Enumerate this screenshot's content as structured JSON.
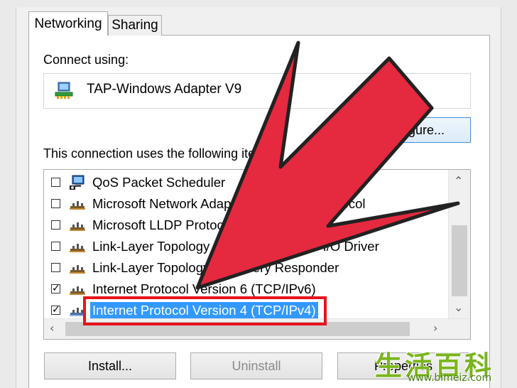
{
  "tabs": [
    {
      "label": "Networking",
      "active": true
    },
    {
      "label": "Sharing",
      "active": false
    }
  ],
  "connect_using": {
    "label": "Connect using:",
    "adapter_name": "TAP-Windows Adapter V9",
    "adapter_icon": "network-adapter-icon"
  },
  "configure_button": {
    "label": "Configure..."
  },
  "items_label": "This connection uses the following items:",
  "items": [
    {
      "label": "QoS Packet Scheduler",
      "checked": false,
      "icon": "qos-scheduler-icon"
    },
    {
      "label": "Microsoft Network Adapter Multiplexor Protocol",
      "checked": false,
      "icon": "network-protocol-icon"
    },
    {
      "label": "Microsoft LLDP Protocol Driver",
      "checked": false,
      "icon": "network-protocol-icon"
    },
    {
      "label": "Link-Layer Topology Discovery Mapper I/O Driver",
      "checked": false,
      "icon": "network-protocol-icon"
    },
    {
      "label": "Link-Layer Topology Discovery Responder",
      "checked": true,
      "icon": "network-protocol-icon"
    },
    {
      "label": "Internet Protocol Version 6 (TCP/IPv6)",
      "checked": true,
      "icon": "network-protocol-icon"
    },
    {
      "label": "Internet Protocol Version 4 (TCP/IPv4)",
      "checked": true,
      "icon": "network-protocol-icon",
      "selected": true
    }
  ],
  "buttons": {
    "install": "Install...",
    "uninstall": "Uninstall",
    "properties": "Properties"
  },
  "watermark": {
    "chars": "生活百科",
    "url": "www.bimeiz.com"
  },
  "colors": {
    "selection": "#3399ff",
    "highlight_border": "#e8131d",
    "arrow_fill": "#e5293f"
  }
}
